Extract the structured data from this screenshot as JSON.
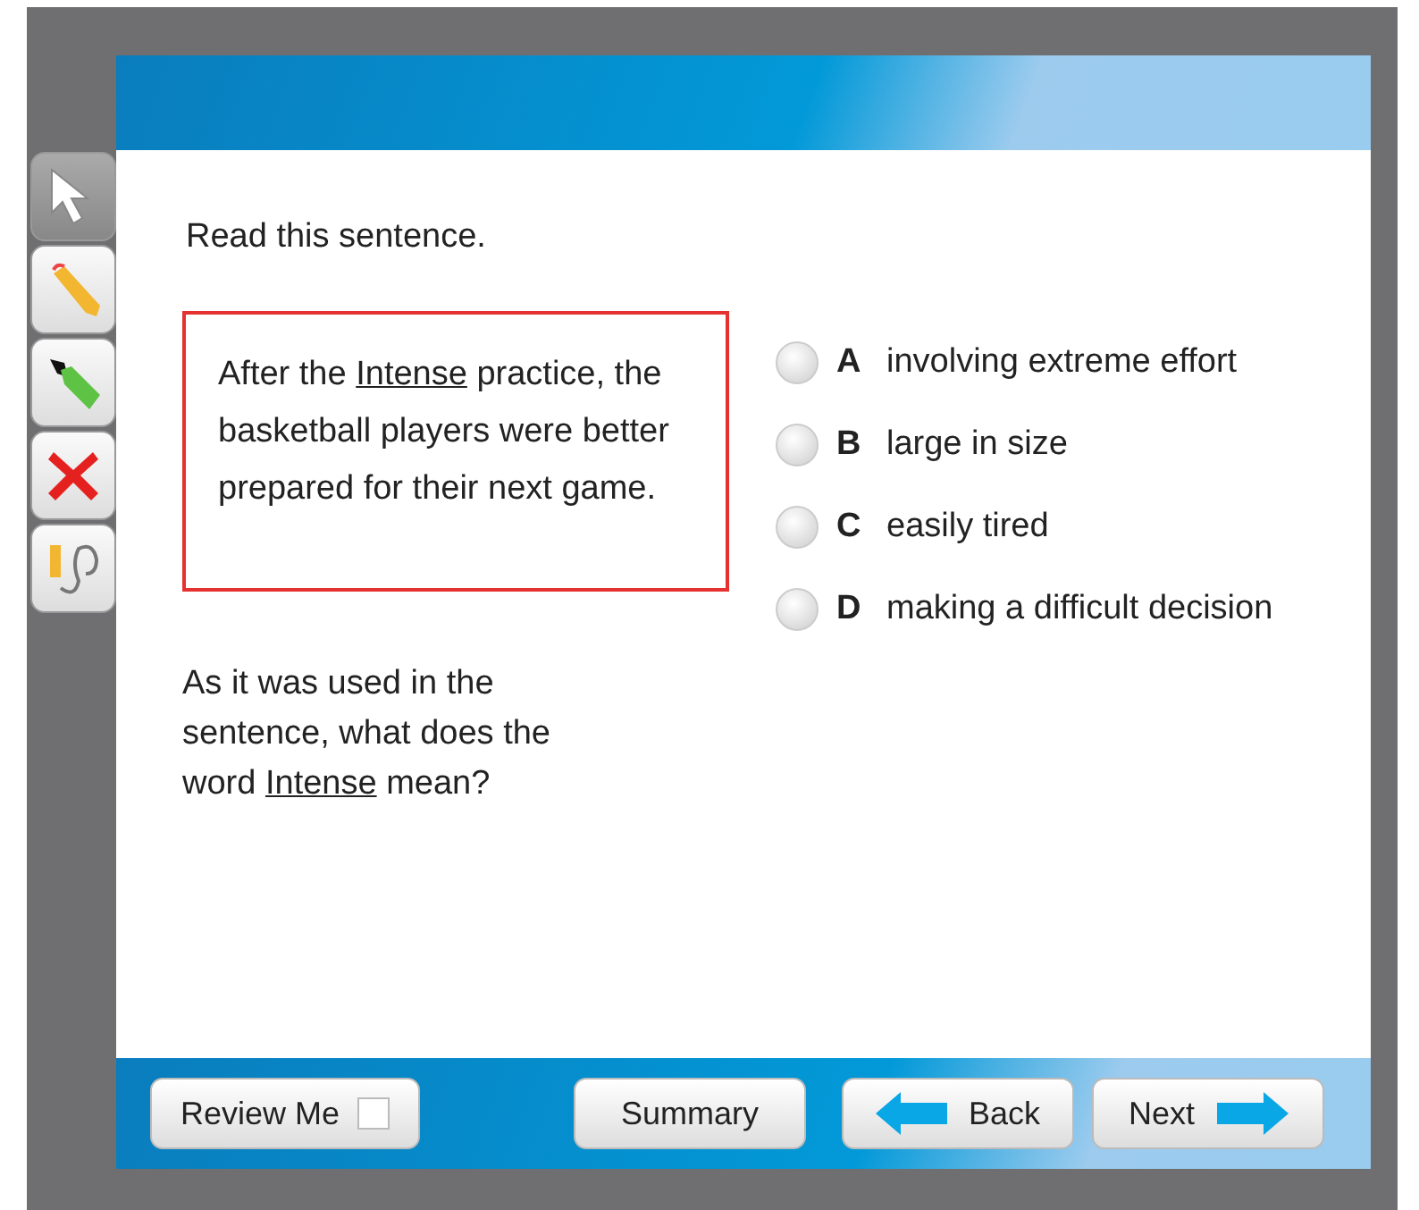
{
  "toolbar": [
    {
      "kind": "pointer"
    },
    {
      "kind": "pencil"
    },
    {
      "kind": "highlighter"
    },
    {
      "kind": "eliminate"
    },
    {
      "kind": "eraser"
    }
  ],
  "instruction": "Read this sentence.",
  "passage": {
    "before": "After the ",
    "underlined": "Intense",
    "after": " practice, the basketball players were better prepared for their next game."
  },
  "question": {
    "before": "As it was used in the sentence, what does the word ",
    "underlined": "Intense",
    "after": " mean?"
  },
  "options": [
    {
      "letter": "A",
      "text": "involving extreme effort",
      "selected": false
    },
    {
      "letter": "B",
      "text": "large in size",
      "selected": false
    },
    {
      "letter": "C",
      "text": "easily tired",
      "selected": false
    },
    {
      "letter": "D",
      "text": "making a difficult decision",
      "selected": false
    }
  ],
  "footer": {
    "review": {
      "label": "Review Me",
      "checked": false
    },
    "summary": "Summary",
    "back": "Back",
    "next": "Next"
  }
}
